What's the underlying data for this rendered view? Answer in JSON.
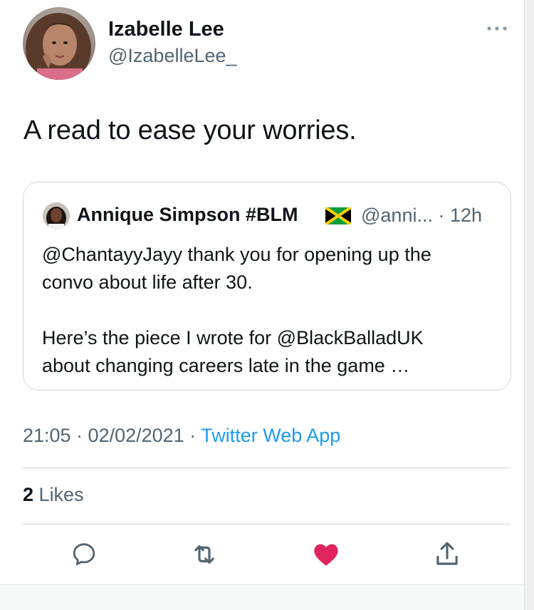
{
  "author": {
    "display_name": "Izabelle Lee",
    "handle": "@IzabelleLee_"
  },
  "tweet": {
    "text": "A read to ease your worries."
  },
  "quoted_tweet": {
    "display_name": "Annique Simpson #BLM",
    "flag_icon": "jamaica-flag-icon",
    "handle_time": "@anni... · 12h",
    "lines": [
      "@ChantayyJayy thank you for opening up the",
      "convo about life after 30.",
      "Here’s the piece I wrote for @BlackBalladUK",
      "about changing careers late in the game …"
    ]
  },
  "meta": {
    "time_date": "21:05 · 02/02/2021 · ",
    "source": "Twitter Web App"
  },
  "stats": {
    "likes_count": "2",
    "likes_label": "Likes"
  },
  "actions": {
    "reply_icon": "reply-icon",
    "retweet_icon": "retweet-icon",
    "like_icon": "heart-icon",
    "share_icon": "share-icon",
    "like_color": "#e0245e"
  },
  "colors": {
    "text": "#0f1419",
    "secondary": "#536471",
    "link": "#1d9bf0",
    "border": "#cfd9de"
  }
}
